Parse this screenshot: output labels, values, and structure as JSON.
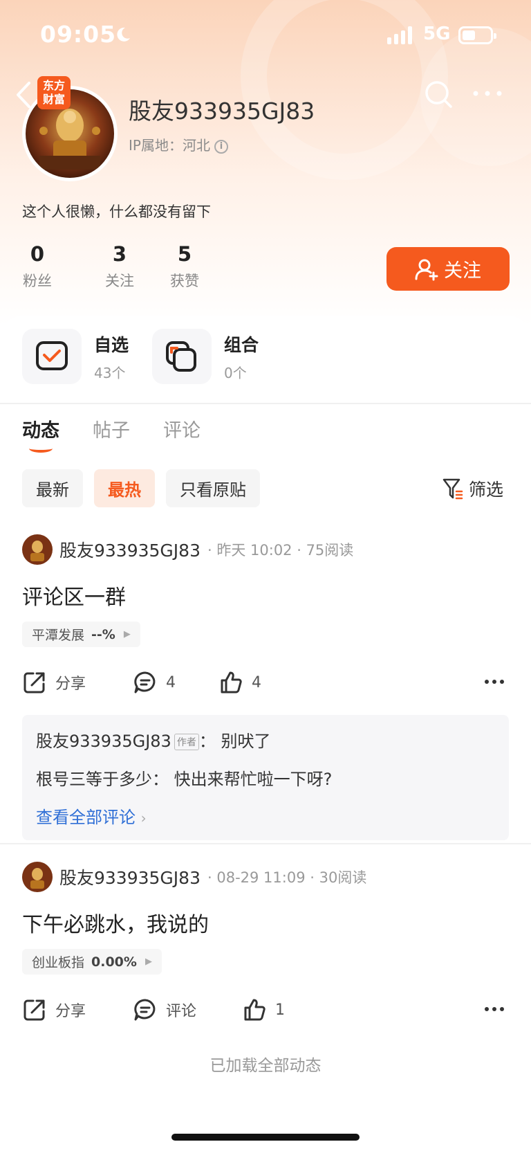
{
  "status_bar": {
    "time": "09:05",
    "network": "5G"
  },
  "brand_badge": "东方财富",
  "profile": {
    "username": "股友933935GJ83",
    "ip_location": "IP属地：河北",
    "bio": "这个人很懒，什么都没有留下",
    "stats": [
      {
        "value": "0",
        "label": "粉丝"
      },
      {
        "value": "3",
        "label": "关注"
      },
      {
        "value": "5",
        "label": "获赞"
      }
    ],
    "follow_label": "关注"
  },
  "quick_entries": [
    {
      "title": "自选",
      "sub": "43个",
      "icon": "watchlist-icon"
    },
    {
      "title": "组合",
      "sub": "0个",
      "icon": "portfolio-icon"
    }
  ],
  "tabs": [
    "动态",
    "帖子",
    "评论"
  ],
  "filters": {
    "chips": [
      "最新",
      "最热",
      "只看原贴"
    ],
    "active": "最热",
    "filter_label": "筛选"
  },
  "posts": [
    {
      "author": "股友933935GJ83",
      "meta": "·  昨天 10:02  ·  75阅读",
      "title": "评论区一群",
      "stock": {
        "name": "平潭发展",
        "pct": "--%"
      },
      "actions": {
        "share": "分享",
        "comment": "4",
        "like": "4"
      },
      "comments": [
        {
          "name": "股友933935GJ83",
          "badge": "作者",
          "text": "别吠了"
        },
        {
          "name": "根号三等于多少",
          "text": "快出来帮忙啦一下呀?"
        }
      ],
      "view_all": "查看全部评论"
    },
    {
      "author": "股友933935GJ83",
      "meta": "·  08-29 11:09  ·  30阅读",
      "title": "下午必跳水，我说的",
      "stock": {
        "name": "创业板指",
        "pct": "0.00%"
      },
      "actions": {
        "share": "分享",
        "comment": "评论",
        "like": "1"
      }
    }
  ],
  "footer_text": "已加载全部动态",
  "colors": {
    "accent": "#f55a1e",
    "link": "#2f6fd6"
  }
}
